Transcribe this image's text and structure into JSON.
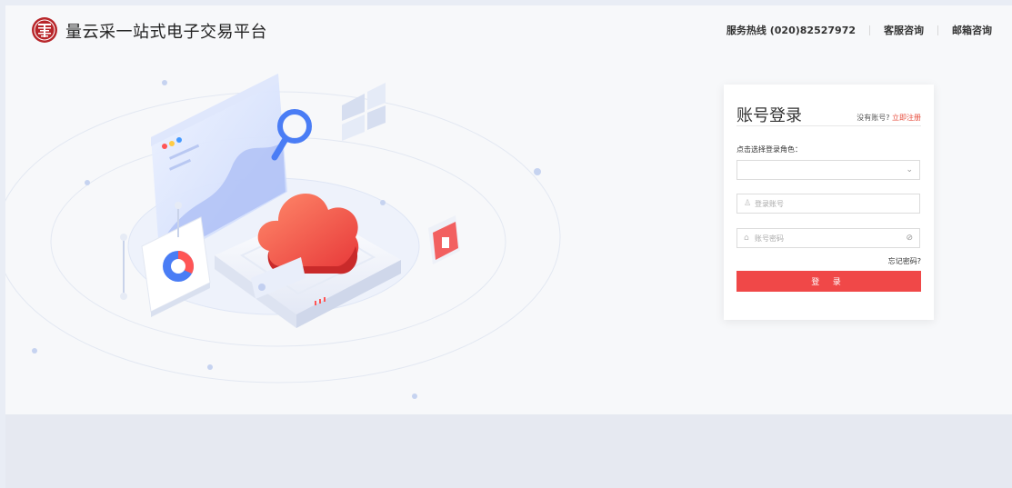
{
  "header": {
    "brand": "量云采一站式电子交易平台",
    "hotline": "服务热线 (020)82527972",
    "service": "客服咨询",
    "email": "邮箱咨询"
  },
  "login": {
    "title": "账号登录",
    "no_account": "没有账号?",
    "register_link": "立即注册",
    "role_label": "点击选择登录角色：",
    "role_value": "",
    "account_placeholder": "登录账号",
    "password_placeholder": "账号密码",
    "forgot": "忘记密码?",
    "submit": "登 录"
  },
  "colors": {
    "accent": "#f04848",
    "link": "#e74c3c"
  },
  "icons": {
    "logo": "brand-logo-icon",
    "user": "user-icon",
    "lock": "lock-icon",
    "eye": "eye-off-icon",
    "chevron": "chevron-down-icon"
  }
}
